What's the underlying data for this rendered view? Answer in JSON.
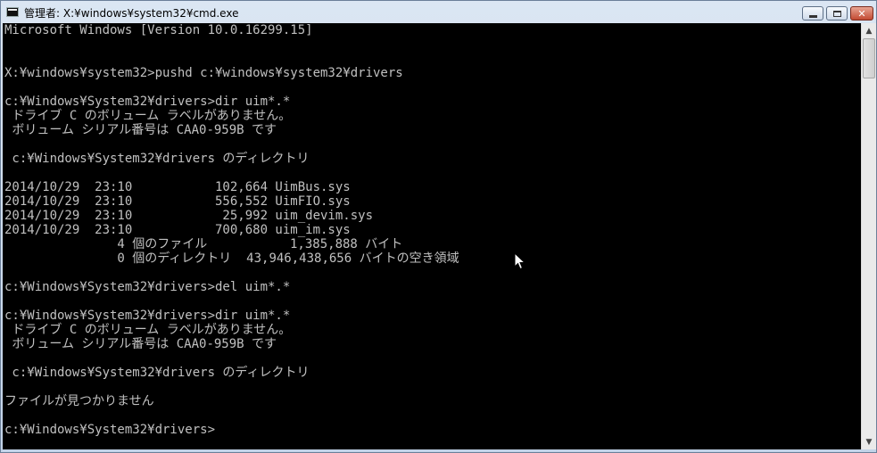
{
  "window": {
    "title": "管理者: X:¥windows¥system32¥cmd.exe"
  },
  "icons": {
    "app": "cmd-app-icon",
    "minimize": "minimize-icon",
    "maximize": "maximize-icon",
    "close": "close-icon",
    "cursor": "mouse-pointer-icon"
  },
  "colors": {
    "console_bg": "#000000",
    "console_text": "#c0c0c0"
  },
  "console": {
    "lines": [
      "Microsoft Windows [Version 10.0.16299.15]",
      "",
      "",
      "X:¥windows¥system32>pushd c:¥windows¥system32¥drivers",
      "",
      "c:¥Windows¥System32¥drivers>dir uim*.*",
      " ドライブ C のボリューム ラベルがありません。",
      " ボリューム シリアル番号は CAA0-959B です",
      "",
      " c:¥Windows¥System32¥drivers のディレクトリ",
      "",
      "2014/10/29  23:10           102,664 UimBus.sys",
      "2014/10/29  23:10           556,552 UimFIO.sys",
      "2014/10/29  23:10            25,992 uim_devim.sys",
      "2014/10/29  23:10           700,680 uim_im.sys",
      "               4 個のファイル           1,385,888 バイト",
      "               0 個のディレクトリ  43,946,438,656 バイトの空き領域",
      "",
      "c:¥Windows¥System32¥drivers>del uim*.*",
      "",
      "c:¥Windows¥System32¥drivers>dir uim*.*",
      " ドライブ C のボリューム ラベルがありません。",
      " ボリューム シリアル番号は CAA0-959B です",
      "",
      " c:¥Windows¥System32¥drivers のディレクトリ",
      "",
      "ファイルが見つかりません",
      "",
      "c:¥Windows¥System32¥drivers>"
    ]
  },
  "scrollbar": {
    "up_arrow": "▲",
    "down_arrow": "▼",
    "position": 0.0
  }
}
